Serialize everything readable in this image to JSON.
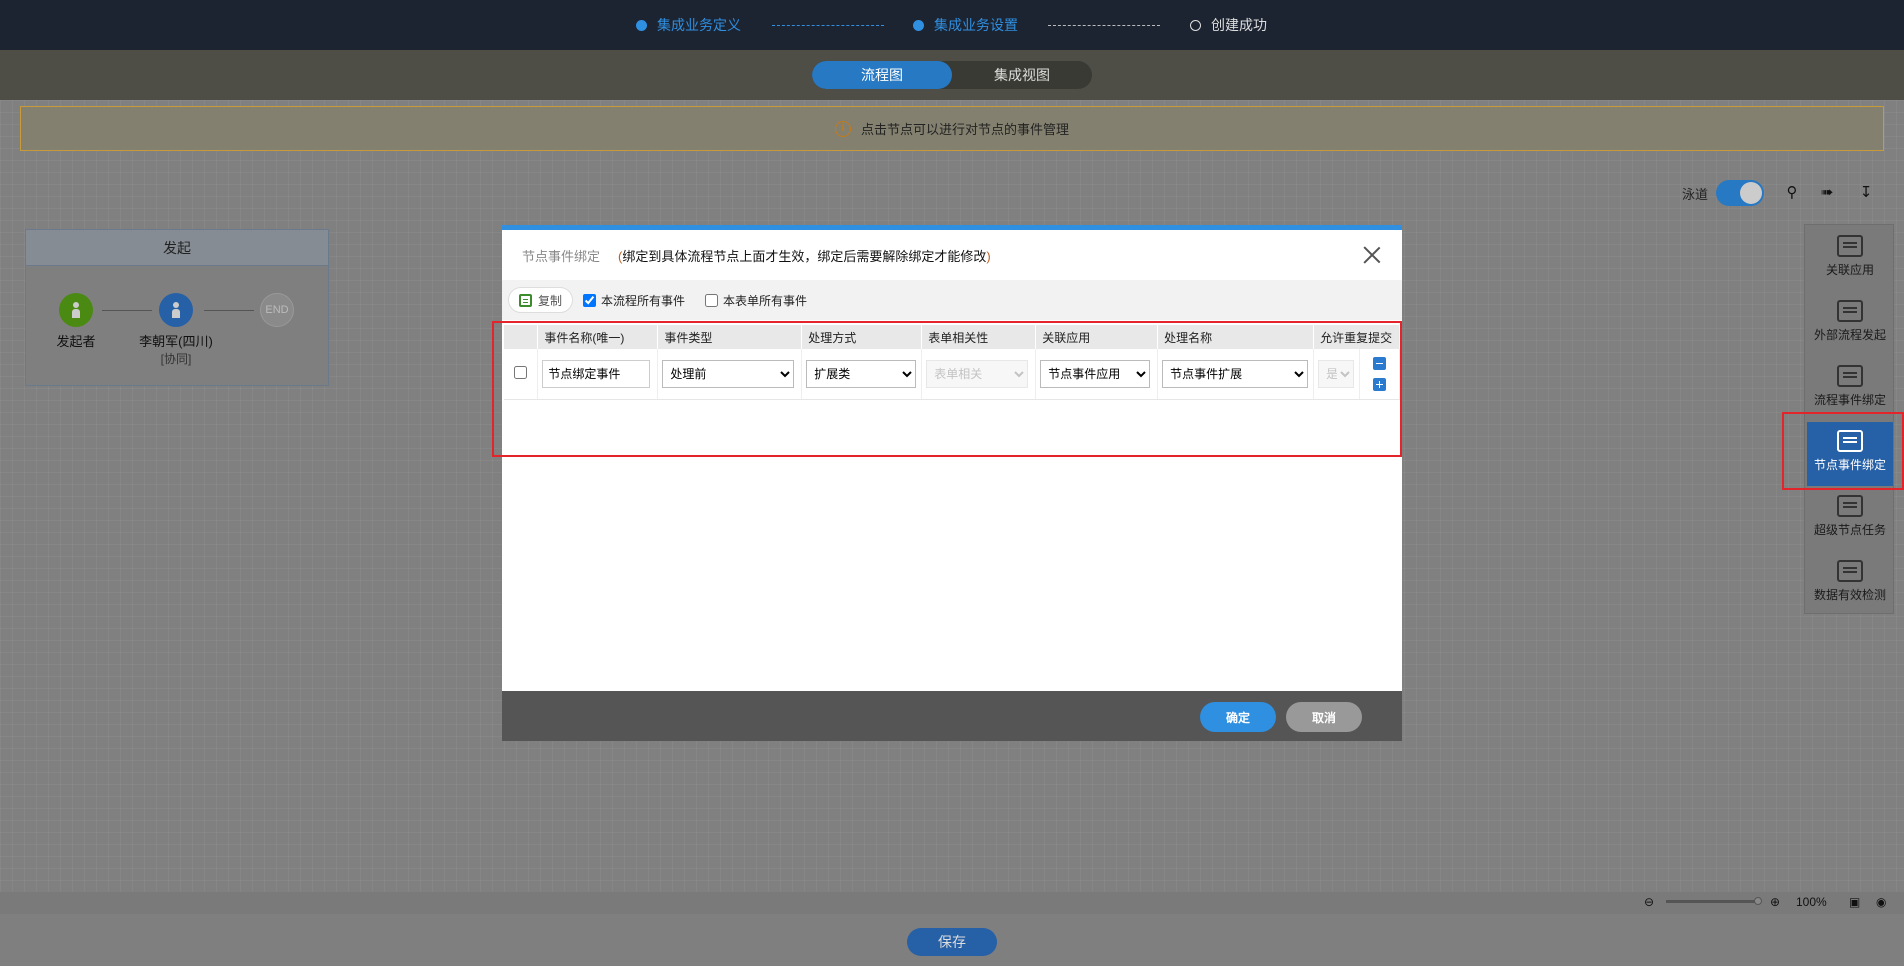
{
  "steps": [
    {
      "label": "集成业务定义",
      "state": "active"
    },
    {
      "label": "集成业务设置",
      "state": "active"
    },
    {
      "label": "创建成功",
      "state": "pending"
    }
  ],
  "view_tabs": {
    "flow": "流程图",
    "integration": "集成视图",
    "selected": "flow"
  },
  "notice": "点击节点可以进行对节点的事件管理",
  "lane": {
    "title": "发起",
    "nodes": [
      {
        "label": "发起者",
        "sub": ""
      },
      {
        "label": "李朝军(四川)",
        "sub": "[协同]"
      },
      {
        "label": "END",
        "sub": ""
      }
    ]
  },
  "toolbar": {
    "swimlane_label": "泳道",
    "swimlane_on": true
  },
  "right_panel": [
    {
      "label": "关联应用",
      "icon": "linked-app-icon",
      "active": false
    },
    {
      "label": "外部流程发起",
      "icon": "external-flow-icon",
      "active": false
    },
    {
      "label": "流程事件绑定",
      "icon": "flow-event-icon",
      "active": false
    },
    {
      "label": "节点事件绑定",
      "icon": "node-event-icon",
      "active": true
    },
    {
      "label": "超级节点任务",
      "icon": "super-node-icon",
      "active": false
    },
    {
      "label": "数据有效检测",
      "icon": "data-check-icon",
      "active": false
    }
  ],
  "zoom": {
    "level": "100%"
  },
  "save_label": "保存",
  "dialog": {
    "title": "节点事件绑定",
    "note_open": "(",
    "note": "绑定到具体流程节点上面才生效，绑定后需要解除绑定才能修改",
    "note_close": ")",
    "copy_label": "复制",
    "cb_all_flow": {
      "label": "本流程所有事件",
      "checked": true
    },
    "cb_all_form": {
      "label": "本表单所有事件",
      "checked": false
    },
    "columns": [
      "事件名称(唯一)",
      "事件类型",
      "处理方式",
      "表单相关性",
      "关联应用",
      "处理名称",
      "允许重复提交"
    ],
    "row": {
      "name": "节点绑定事件",
      "type": "处理前",
      "method": "扩展类",
      "form_rel": "表单相关",
      "app": "节点事件应用",
      "handler": "节点事件扩展",
      "repeat": "是"
    },
    "ok_label": "确定",
    "cancel_label": "取消"
  },
  "colors": {
    "accent": "#2f8fe0",
    "highlight": "#e3242b",
    "topbar": "#1c2331"
  }
}
